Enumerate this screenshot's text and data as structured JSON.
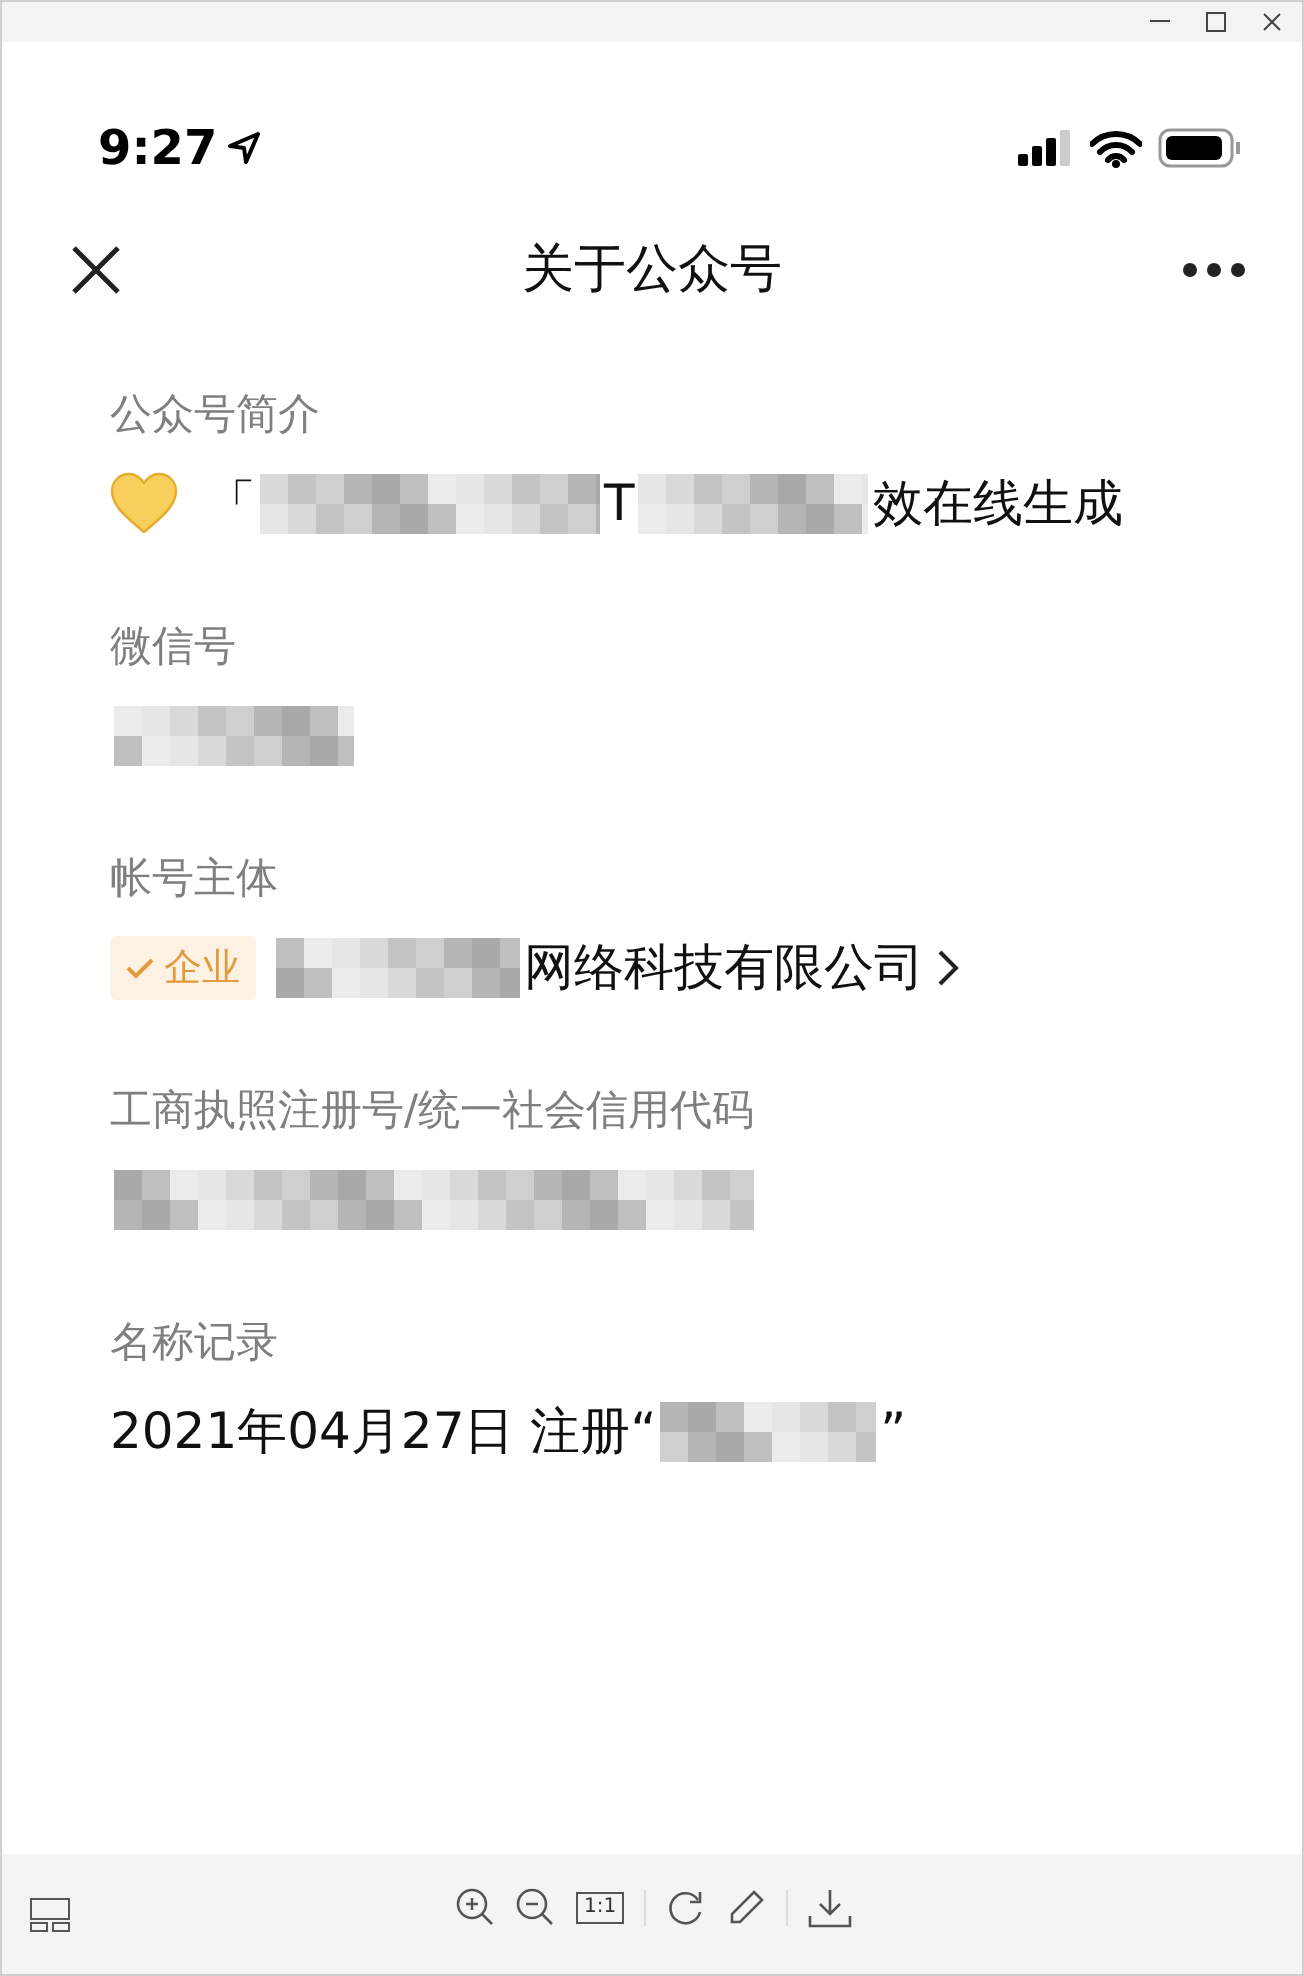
{
  "status_bar": {
    "time": "9:27"
  },
  "header": {
    "title": "关于公众号"
  },
  "sections": [
    {
      "label": "公众号简介",
      "segments": [
        {
          "kind": "heart"
        },
        {
          "kind": "text",
          "text": "「"
        },
        {
          "kind": "redacted"
        },
        {
          "kind": "text",
          "text": "T"
        },
        {
          "kind": "redacted"
        },
        {
          "kind": "text",
          "text": "效在线生成"
        }
      ]
    },
    {
      "label": "微信号",
      "segments": [
        {
          "kind": "redacted"
        }
      ]
    },
    {
      "label": "帐号主体",
      "segments": [
        {
          "kind": "badge",
          "text": "企业",
          "verified": true
        },
        {
          "kind": "redacted"
        },
        {
          "kind": "text",
          "text": "网络科技有限公司"
        },
        {
          "kind": "chevron"
        }
      ]
    },
    {
      "label": "工商执照注册号/统一社会信用代码",
      "segments": [
        {
          "kind": "redacted"
        }
      ]
    },
    {
      "label": "名称记录",
      "segments": [
        {
          "kind": "text",
          "text": "2021年04月27日 注册“"
        },
        {
          "kind": "redacted"
        },
        {
          "kind": "text",
          "text": "”"
        }
      ]
    }
  ],
  "toolbar": {
    "actual_size_label": "1:1"
  }
}
